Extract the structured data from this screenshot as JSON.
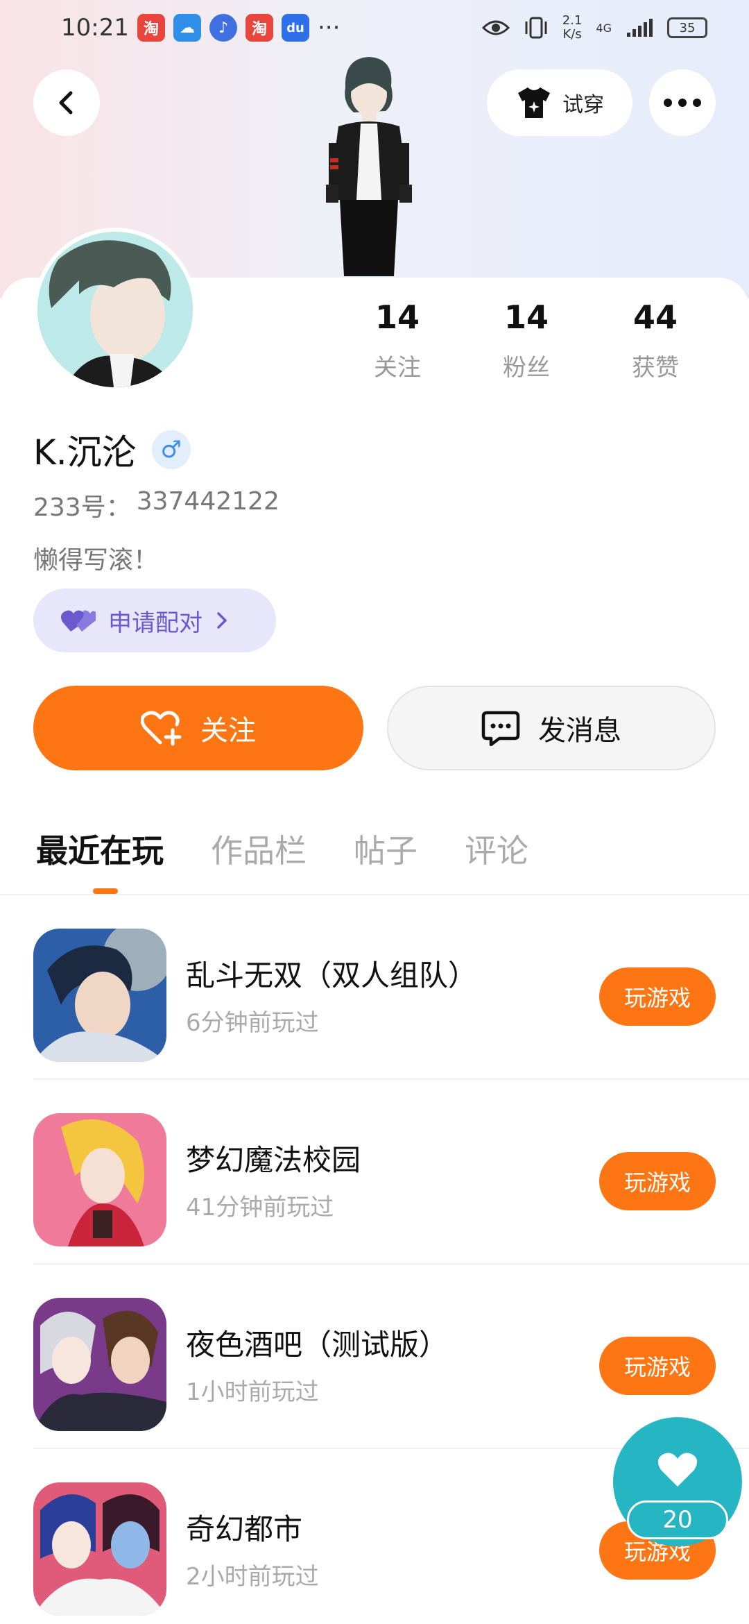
{
  "status_bar": {
    "time": "10:21",
    "apps": [
      {
        "name": "taobao-icon",
        "glyph": "淘",
        "color": "#e8453c"
      },
      {
        "name": "weather-icon",
        "glyph": "☁",
        "color": "#2f8ee8"
      },
      {
        "name": "music-icon",
        "glyph": "♪",
        "color": "#3f6fe0"
      },
      {
        "name": "taobao-icon",
        "glyph": "淘",
        "color": "#e8453c"
      },
      {
        "name": "baidu-icon",
        "glyph": "du",
        "color": "#2f6fe8"
      }
    ],
    "more": "···",
    "speed_top": "2.1",
    "speed_bottom": "K/s",
    "network": "4G",
    "battery": "35"
  },
  "header": {
    "try_on_label": "试穿"
  },
  "profile": {
    "stats": [
      {
        "value": "14",
        "label": "关注"
      },
      {
        "value": "14",
        "label": "粉丝"
      },
      {
        "value": "44",
        "label": "获赞"
      }
    ],
    "username": "K.沉沦",
    "gender": "♂",
    "uid_label": "233号：",
    "uid": "337442122",
    "bio": "懒得写滚！",
    "pair_label": "申请配对",
    "follow_label": "关注",
    "message_label": "发消息"
  },
  "tabs": [
    {
      "label": "最近在玩",
      "active": true
    },
    {
      "label": "作品栏",
      "active": false
    },
    {
      "label": "帖子",
      "active": false
    },
    {
      "label": "评论",
      "active": false
    }
  ],
  "games": [
    {
      "title": "乱斗无双（双人组队）",
      "time": "6分钟前玩过",
      "play_label": "玩游戏",
      "accent": "#2d5fa8"
    },
    {
      "title": "梦幻魔法校园",
      "time": "41分钟前玩过",
      "play_label": "玩游戏",
      "accent": "#f07a9a"
    },
    {
      "title": "夜色酒吧（测试版）",
      "time": "1小时前玩过",
      "play_label": "玩游戏",
      "accent": "#7a3a8a"
    },
    {
      "title": "奇幻都市",
      "time": "2小时前玩过",
      "play_label": "玩游戏",
      "accent": "#e05a7a"
    }
  ],
  "like": {
    "count": "20"
  },
  "colors": {
    "accent_orange": "#fe7514",
    "like_teal": "#26b5c2",
    "pair_purple": "#6a5acd"
  }
}
